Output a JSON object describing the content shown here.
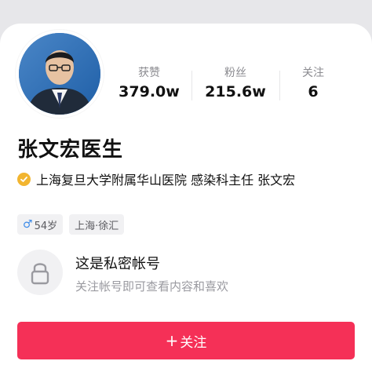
{
  "profile": {
    "name": "张文宏医生",
    "verification": "上海复旦大学附属华山医院 感染科主任 张文宏",
    "avatar_icon": "avatar-photo"
  },
  "stats": {
    "likes_label": "获赞",
    "likes_value": "379.0w",
    "followers_label": "粉丝",
    "followers_value": "215.6w",
    "following_label": "关注",
    "following_value": "6"
  },
  "tags": {
    "gender_symbol": "♂",
    "age": "54岁",
    "location": "上海·徐汇"
  },
  "private_account": {
    "title": "这是私密帐号",
    "subtitle": "关注帐号即可查看内容和喜欢"
  },
  "actions": {
    "follow_plus": "+",
    "follow_label": "关注"
  },
  "colors": {
    "accent": "#f53057",
    "verify": "#f2b530",
    "gender": "#3d8be8"
  }
}
